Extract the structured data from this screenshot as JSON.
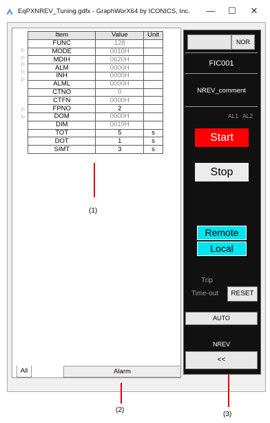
{
  "window": {
    "title": "EqPXNREV_Tuning.gdfx - GraphWorX64 by ICONICS, Inc.",
    "minimize_glyph": "—",
    "maximize_glyph": "☐",
    "close_glyph": "✕"
  },
  "table": {
    "headers": {
      "item": "Item",
      "value": "Value",
      "unit": "Unit"
    },
    "rows": [
      {
        "item": "FUNC",
        "value": "128",
        "unit": "",
        "dim": true,
        "expandable": false
      },
      {
        "item": "MODE",
        "value": "0010H",
        "unit": "",
        "dim": true,
        "expandable": true
      },
      {
        "item": "MDIH",
        "value": "0620H",
        "unit": "",
        "dim": true,
        "expandable": true
      },
      {
        "item": "ALM",
        "value": "0000H",
        "unit": "",
        "dim": true,
        "expandable": true
      },
      {
        "item": "INH",
        "value": "0000H",
        "unit": "",
        "dim": true,
        "expandable": true
      },
      {
        "item": "ALML",
        "value": "0000H",
        "unit": "",
        "dim": true,
        "expandable": true
      },
      {
        "item": "CTNO",
        "value": "0",
        "unit": "",
        "dim": true,
        "expandable": false
      },
      {
        "item": "CTFN",
        "value": "0000H",
        "unit": "",
        "dim": true,
        "expandable": false
      },
      {
        "item": "FPNO",
        "value": "2",
        "unit": "",
        "dim": false,
        "expandable": false
      },
      {
        "item": "DOM",
        "value": "0000H",
        "unit": "",
        "dim": true,
        "expandable": true
      },
      {
        "item": "DIM",
        "value": "0019H",
        "unit": "",
        "dim": true,
        "expandable": true
      },
      {
        "item": "TOT",
        "value": "5",
        "unit": "s",
        "dim": false,
        "expandable": false
      },
      {
        "item": "DOT",
        "value": "1",
        "unit": "s",
        "dim": false,
        "expandable": false
      },
      {
        "item": "SIMT",
        "value": "3",
        "unit": "s",
        "dim": false,
        "expandable": false
      }
    ]
  },
  "tabs": {
    "all": "All",
    "alarm": "Alarm"
  },
  "annotations": {
    "one": "(1)",
    "two": "(2)",
    "three": "(3)"
  },
  "faceplate": {
    "top_left_button": "",
    "top_right_button": "NOR",
    "tag": "FIC001",
    "comment": "NREV_comment",
    "al1": "AL1",
    "al2": "AL2",
    "start": "Start",
    "stop": "Stop",
    "remote": "Remote",
    "local": "Local",
    "trip": "Trip",
    "timeout": "Time-out",
    "reset": "RESET",
    "auto": "AUTO",
    "nrev": "NREV",
    "back": "<<"
  },
  "colors": {
    "start_bg": "#ff0000",
    "stop_bg": "#ececec",
    "cyan": "#00e5ee",
    "annotation_red": "#e00000",
    "faceplate_bg": "#111111"
  }
}
